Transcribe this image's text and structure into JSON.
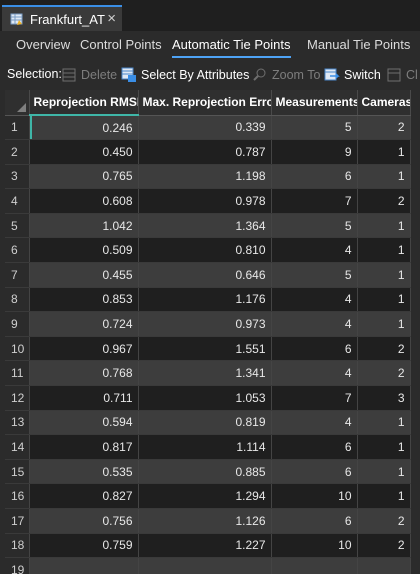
{
  "doc_tab": {
    "title": "Frankfurt_AT",
    "close": "×"
  },
  "view_tabs": [
    "Overview",
    "Control Points",
    "Automatic Tie Points",
    "Manual Tie Points"
  ],
  "active_tab": "Automatic Tie Points",
  "toolbar": {
    "selection_label": "Selection:",
    "delete": "Delete",
    "select_by_attributes": "Select By Attributes",
    "zoom_to": "Zoom To",
    "switch": "Switch",
    "clear": "Cl"
  },
  "table": {
    "columns": [
      "Reprojection RMSE",
      "Max. Reprojection Error",
      "Measurements",
      "Cameras"
    ],
    "rows": [
      [
        "1",
        "0.246",
        "0.339",
        "5",
        "2"
      ],
      [
        "2",
        "0.450",
        "0.787",
        "9",
        "1"
      ],
      [
        "3",
        "0.765",
        "1.198",
        "6",
        "1"
      ],
      [
        "4",
        "0.608",
        "0.978",
        "7",
        "2"
      ],
      [
        "5",
        "1.042",
        "1.364",
        "5",
        "1"
      ],
      [
        "6",
        "0.509",
        "0.810",
        "4",
        "1"
      ],
      [
        "7",
        "0.455",
        "0.646",
        "5",
        "1"
      ],
      [
        "8",
        "0.853",
        "1.176",
        "4",
        "1"
      ],
      [
        "9",
        "0.724",
        "0.973",
        "4",
        "1"
      ],
      [
        "10",
        "0.967",
        "1.551",
        "6",
        "2"
      ],
      [
        "11",
        "0.768",
        "1.341",
        "4",
        "2"
      ],
      [
        "12",
        "0.711",
        "1.053",
        "7",
        "3"
      ],
      [
        "13",
        "0.594",
        "0.819",
        "4",
        "1"
      ],
      [
        "14",
        "0.817",
        "1.114",
        "6",
        "1"
      ],
      [
        "15",
        "0.535",
        "0.885",
        "6",
        "1"
      ],
      [
        "16",
        "0.827",
        "1.294",
        "10",
        "1"
      ],
      [
        "17",
        "0.756",
        "1.126",
        "6",
        "2"
      ],
      [
        "18",
        "0.759",
        "1.227",
        "10",
        "2"
      ],
      [
        "19",
        "",
        "",
        "",
        ""
      ]
    ]
  },
  "colors": {
    "accent": "#3fb6a8",
    "tab_underline": "#4ea3f5",
    "row_light": "#3d3d3d",
    "row_dark": "#1f1f1f"
  }
}
